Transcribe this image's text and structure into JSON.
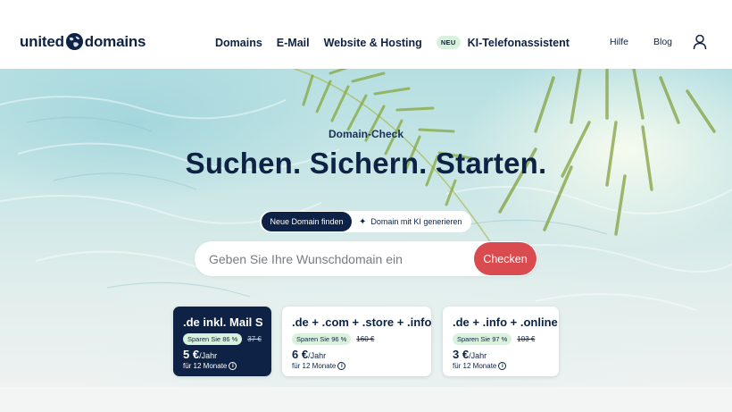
{
  "header": {
    "logo_left": "united",
    "logo_right": "domains",
    "nav": [
      "Domains",
      "E-Mail",
      "Website & Hosting"
    ],
    "new_badge": "NEU",
    "new_item": "KI-Telefonassistent",
    "help": "Hilfe",
    "blog": "Blog"
  },
  "hero": {
    "eyebrow": "Domain-Check",
    "headline": "Suchen. Sichern. Starten.",
    "toggle": {
      "active": "Neue Domain finden",
      "ai": "Domain mit KI generieren"
    },
    "search": {
      "placeholder": "Geben Sie Ihre Wunschdomain ein",
      "button": "Checken"
    }
  },
  "cards": [
    {
      "title": ".de inkl. Mail S",
      "save": "Sparen Sie 86 %",
      "old_price": "37 €",
      "price": "5 €",
      "per": "/Jahr",
      "period": "für 12 Monate"
    },
    {
      "title": ".de + .com + .store + .info",
      "save": "Sparen Sie 96 %",
      "old_price": "160 €",
      "price": "6 €",
      "per": "/Jahr",
      "period": "für 12 Monate"
    },
    {
      "title": ".de + .info + .online",
      "save": "Sparen Sie 97 %",
      "old_price": "103 €",
      "price": "3 €",
      "per": "/Jahr",
      "period": "für 12 Monate"
    }
  ],
  "colors": {
    "navy": "#0d2244",
    "accent_red": "#d94b4e",
    "badge_green": "#d8f2de"
  },
  "icons": [
    "globe-icon",
    "user-icon",
    "sparkle-icon",
    "info-icon"
  ]
}
